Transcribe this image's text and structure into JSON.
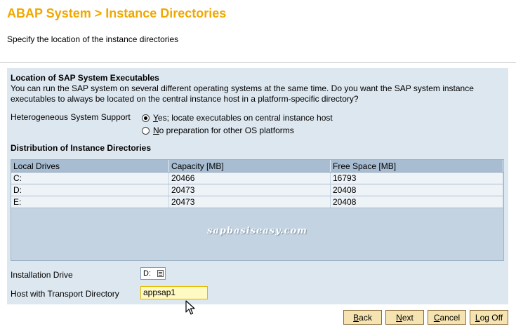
{
  "page": {
    "title": "ABAP System > Instance Directories",
    "subtitle": "Specify the location of the instance directories"
  },
  "executables": {
    "heading": "Location of SAP System Executables",
    "description": "You can run the SAP system on several different operating systems at the same time. Do you want the SAP system instance executables to always be located on the central instance host in a platform-specific directory?",
    "hetero_label": "Heterogeneous System Support",
    "options": [
      {
        "label": "Yes; locate executables on central instance host",
        "checked": true
      },
      {
        "label": "No preparation for other OS platforms",
        "checked": false
      }
    ]
  },
  "distribution": {
    "heading": "Distribution of Instance Directories",
    "columns": [
      "Local Drives",
      "Capacity [MB]",
      "Free Space [MB]"
    ],
    "rows": [
      [
        "C:",
        "20466",
        "16793"
      ],
      [
        "D:",
        "20473",
        "20408"
      ],
      [
        "E:",
        "20473",
        "20408"
      ]
    ],
    "watermark": "sapbasiseasy.com"
  },
  "form": {
    "install_drive_label": "Installation Drive",
    "install_drive_value": "D:",
    "host_label": "Host with Transport Directory",
    "host_value": "appsap1"
  },
  "buttons": {
    "back": "Back",
    "next": "Next",
    "cancel": "Cancel",
    "logoff": "Log Off"
  },
  "colors": {
    "title": "#f0a800",
    "panel": "#dde7ef",
    "button": "#f5e3b2",
    "input_highlight": "#fff9c4"
  }
}
